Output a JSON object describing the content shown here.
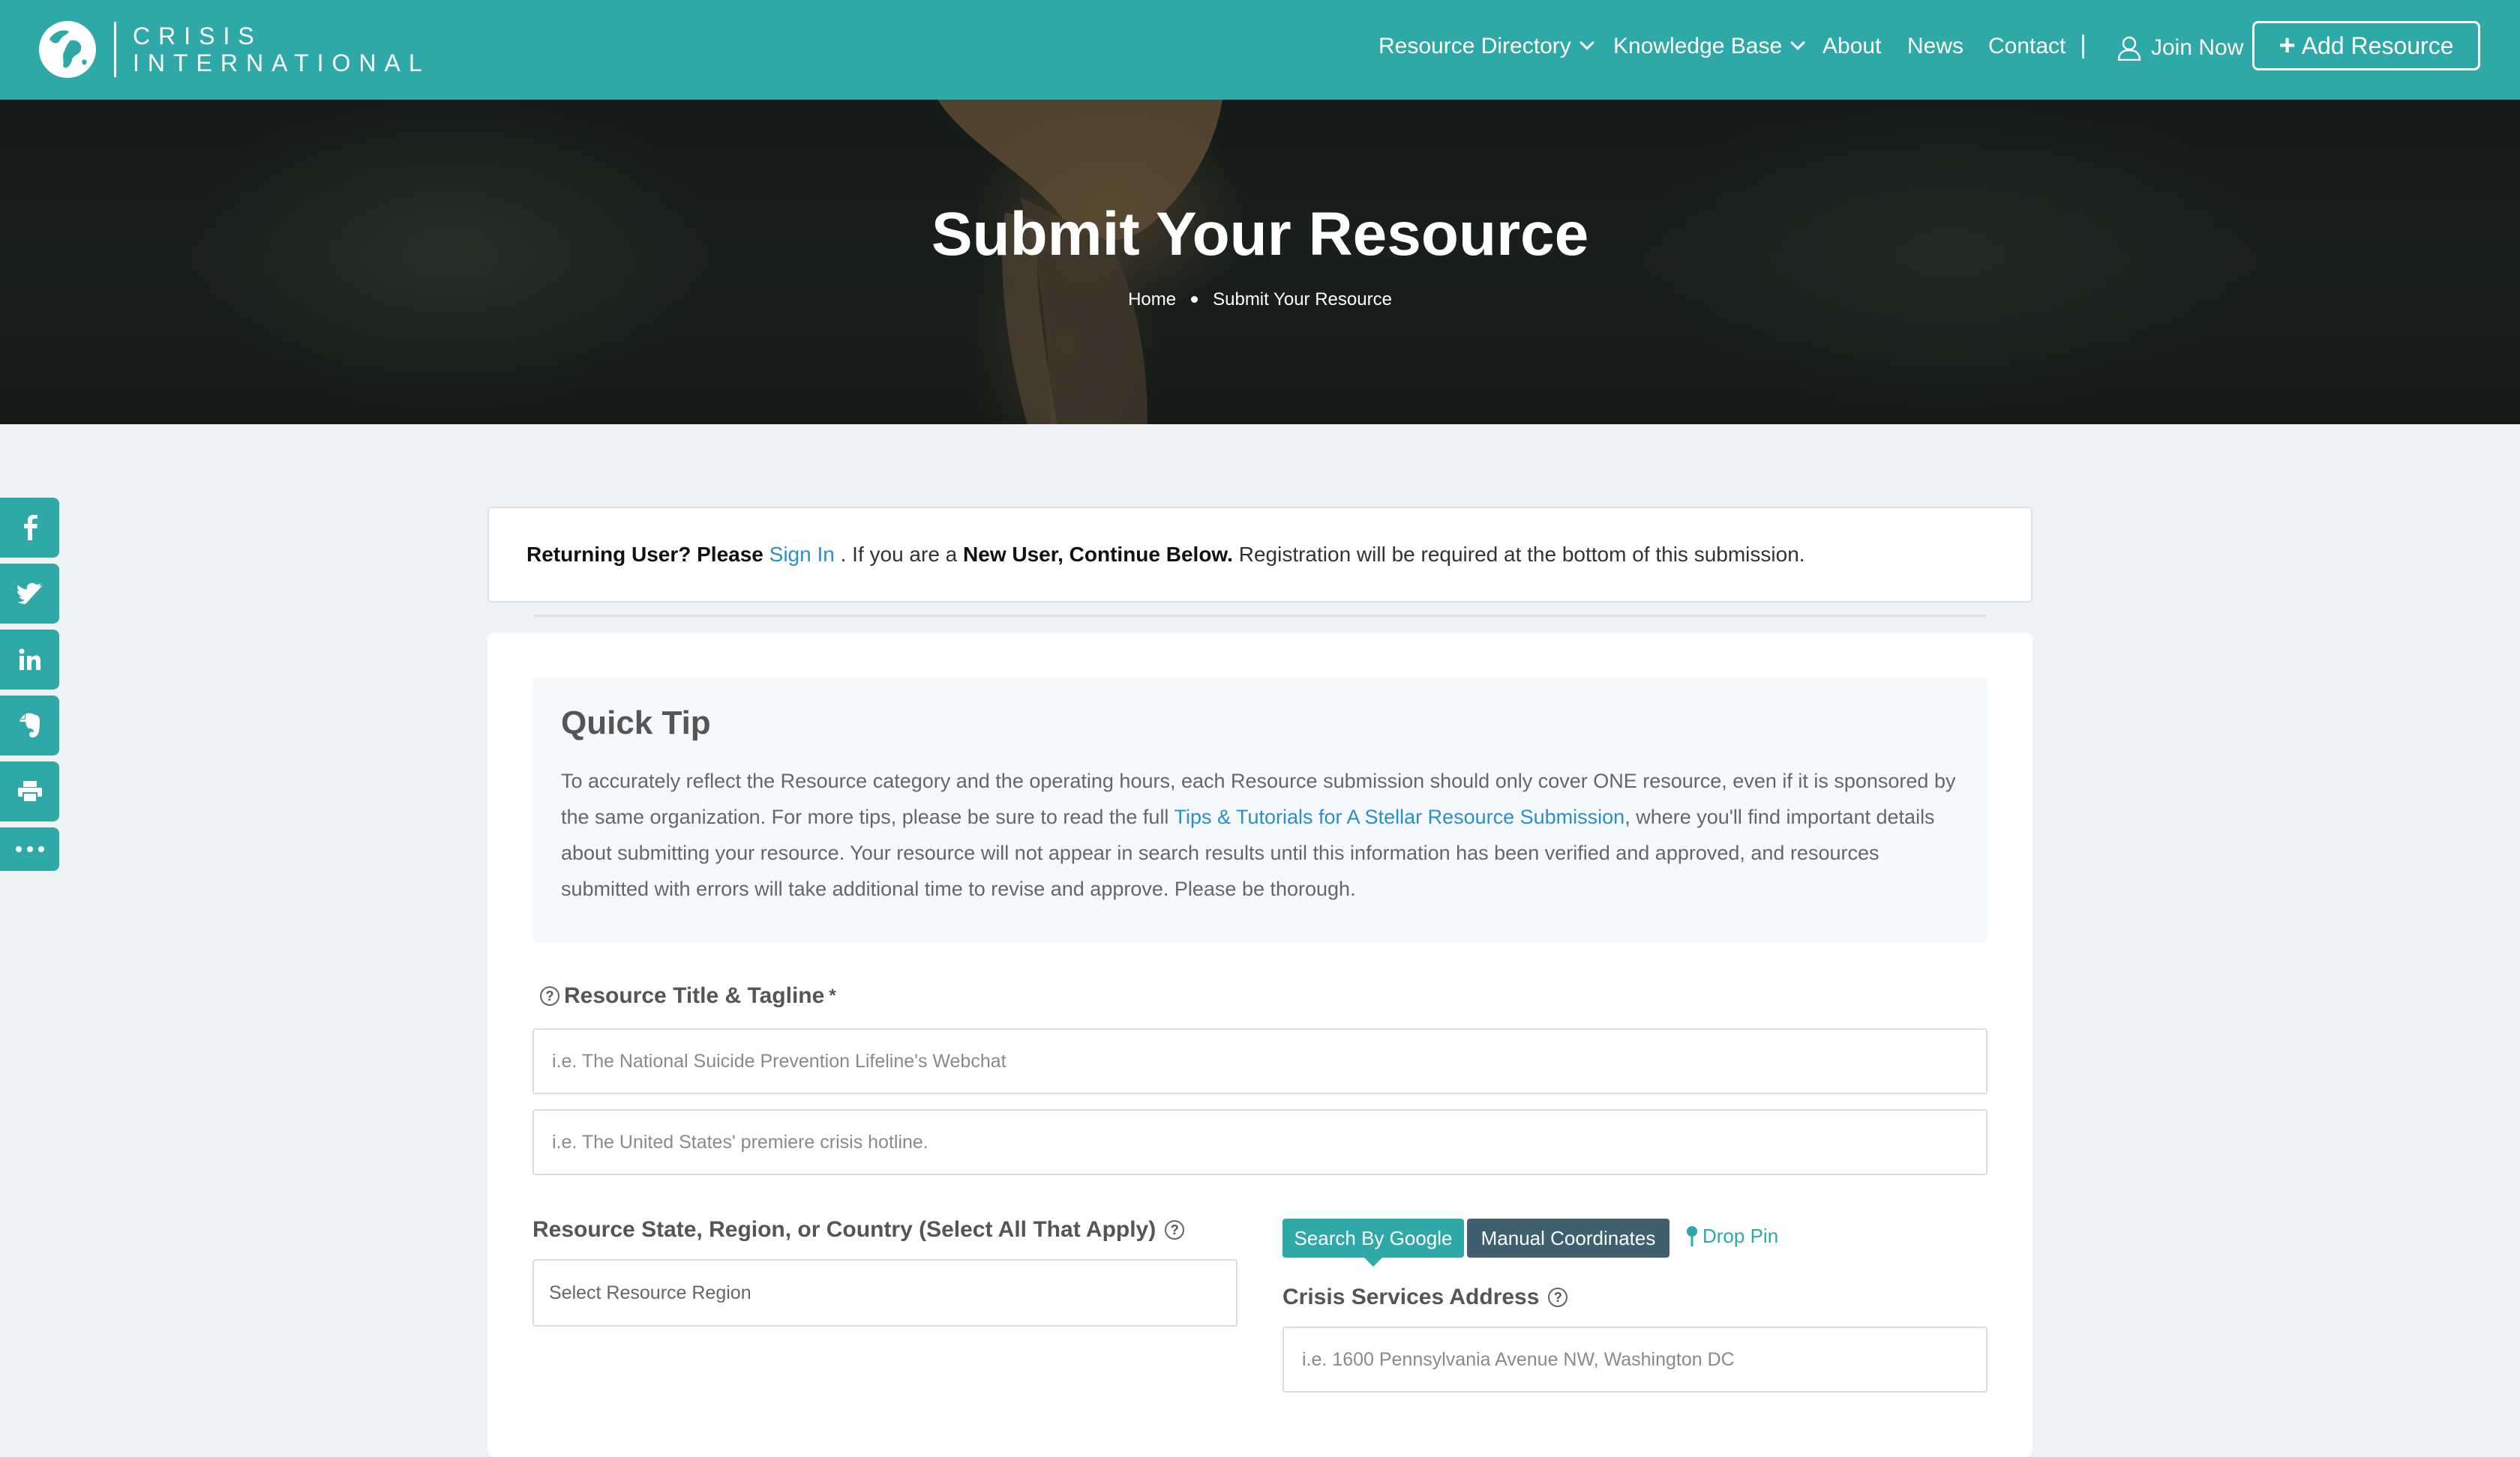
{
  "brand": {
    "line1": "CRISIS",
    "line2": "INTERNATIONAL"
  },
  "nav": {
    "items": [
      "Resource Directory",
      "Knowledge Base",
      "About",
      "News",
      "Contact"
    ],
    "join": "Join Now",
    "add": "Add Resource"
  },
  "hero": {
    "title": "Submit Your Resource",
    "breadcrumb": [
      "Home",
      "Submit Your Resource"
    ]
  },
  "social": [
    "facebook-icon",
    "twitter-icon",
    "linkedin-icon",
    "evernote-icon",
    "print-icon",
    "more-icon"
  ],
  "notice": {
    "returning": "Returning User? Please",
    "signin": "Sign In",
    "mid": ". If you are a",
    "newuser": "New User, Continue Below.",
    "rest": "Registration will be required at the bottom of this submission."
  },
  "tip": {
    "title": "Quick Tip",
    "text1": "To accurately reflect the Resource category and the operating hours, each Resource submission should only cover ONE resource, even if it is sponsored by the same organization. For more tips, please be sure to read the full",
    "link": "Tips & Tutorials for A Stellar Resource Submission",
    "text2": ", where you'll find important details about submitting your resource. Your resource will not appear in search results until this information has been verified and approved, and resources submitted with errors will take additional time to revise and approve. Please be thorough."
  },
  "form": {
    "title_label": "Resource Title & Tagline",
    "required": "*",
    "title_placeholder": "i.e. The National Suicide Prevention Lifeline's Webchat",
    "tagline_placeholder": "i.e. The United States' premiere crisis hotline.",
    "region_label": "Resource State, Region, or Country (Select All That Apply)",
    "region_placeholder": "Select Resource Region",
    "tabs": [
      "Search By Google",
      "Manual Coordinates"
    ],
    "drop_pin": "Drop Pin",
    "address_label": "Crisis Services Address",
    "address_placeholder": "i.e. 1600 Pennsylvania Avenue NW, Washington DC"
  },
  "colors": {
    "accent": "#2fa8a8",
    "dark_tab": "#3d5f6e",
    "link": "#2a8fc9"
  }
}
